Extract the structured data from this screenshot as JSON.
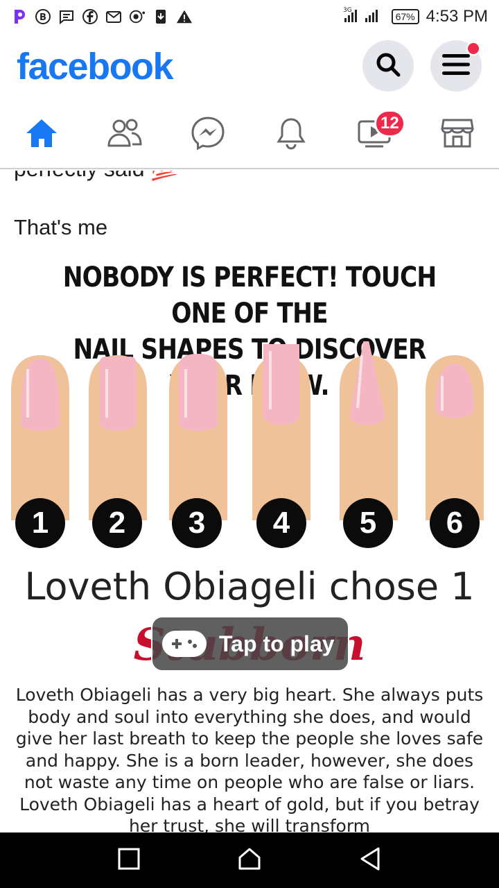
{
  "status_bar": {
    "time": "4:53 PM",
    "battery": "67%",
    "network": "3G",
    "left_icons": [
      "picsart-icon",
      "b-badge-icon",
      "message-icon",
      "facebook-icon",
      "gmail-icon",
      "record-icon",
      "download-icon",
      "warning-icon"
    ]
  },
  "header": {
    "logo": "facebook",
    "search_icon": "search-icon",
    "menu_icon": "menu-icon"
  },
  "nav": {
    "tabs": [
      {
        "name": "home",
        "icon": "home-icon",
        "active": true
      },
      {
        "name": "friends",
        "icon": "friends-icon"
      },
      {
        "name": "messenger",
        "icon": "messenger-icon"
      },
      {
        "name": "notifications",
        "icon": "bell-icon"
      },
      {
        "name": "watch",
        "icon": "video-icon",
        "badge": "12"
      },
      {
        "name": "marketplace",
        "icon": "store-icon"
      }
    ]
  },
  "post": {
    "cut_text": "perfectly said 💯",
    "text": "That's me"
  },
  "quiz": {
    "title_line1": "NOBODY IS PERFECT! TOUCH ONE OF THE",
    "title_line2": "NAIL SHAPES TO DISCOVER YOUR FLAW.",
    "numbers": [
      "1",
      "2",
      "3",
      "4",
      "5",
      "6"
    ],
    "result": "Loveth Obiageli chose 1",
    "trait": "Stubborn",
    "description": "Loveth Obiageli has a very big heart. She always puts body and soul into everything she does, and would give her last breath to keep the people she loves safe and happy. She is a born leader, however, she does not waste any time on people who are false or liars. Loveth Obiageli has a heart of gold, but if you betray her trust, she will transform",
    "play_label": "Tap to play"
  },
  "colors": {
    "facebook_blue": "#1877f2",
    "badge_red": "#f02849",
    "trait_red": "#c8102e",
    "nail_pink": "#f4b6c2",
    "skin": "#f0c29a"
  }
}
